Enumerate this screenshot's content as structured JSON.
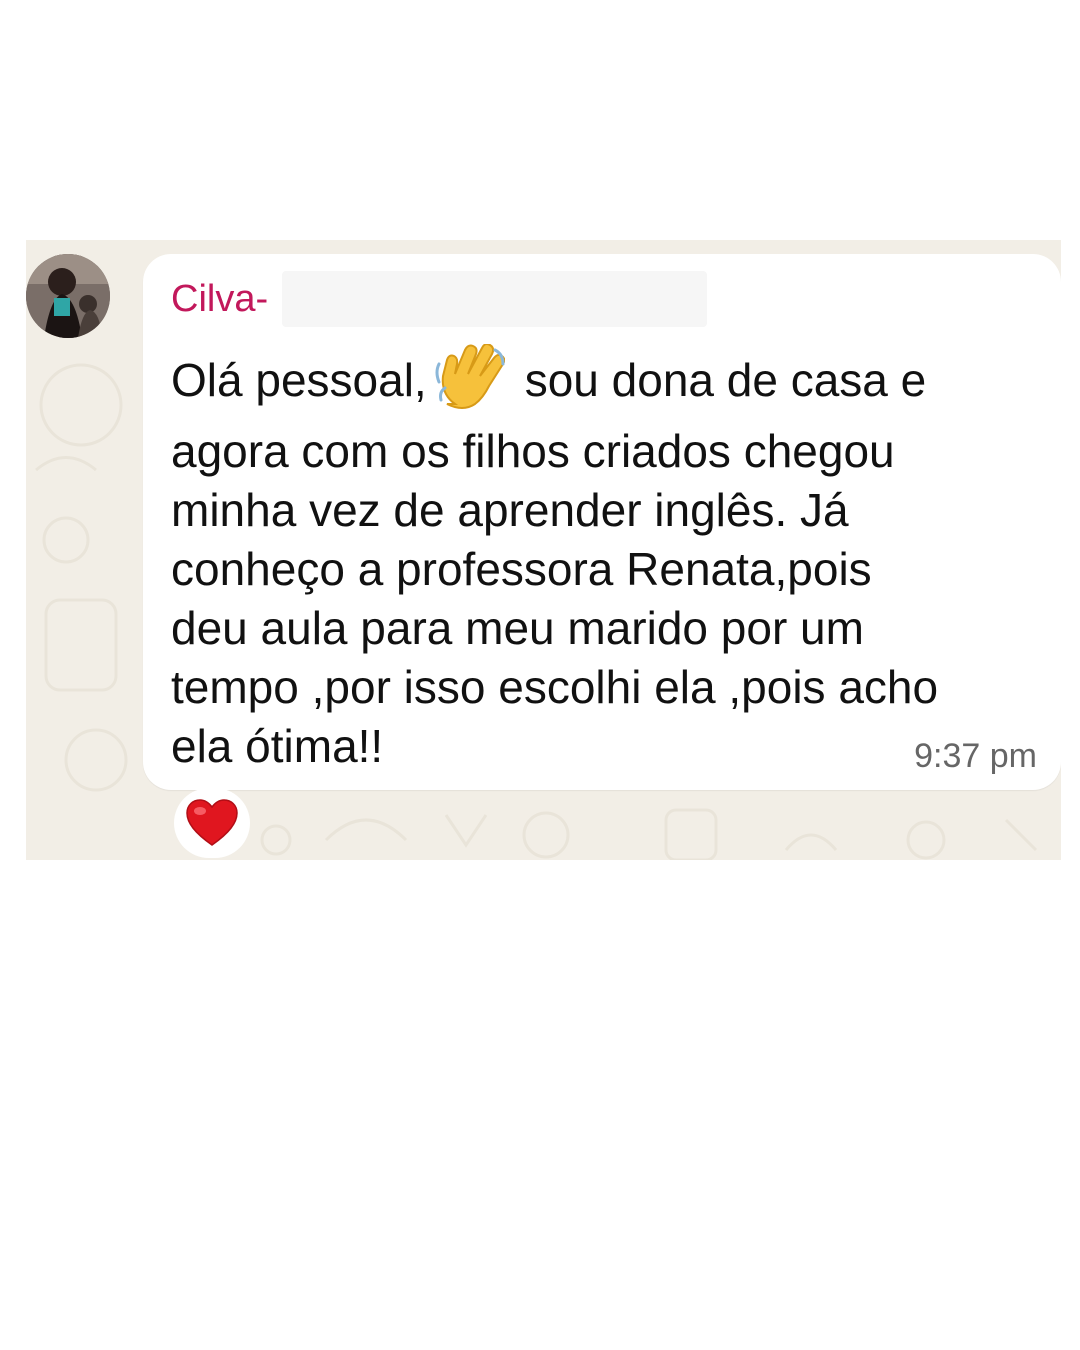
{
  "message": {
    "sender_name": "Cilva-",
    "text_lines": [
      [
        "Olá pessoal,",
        "sou dona de casa  e"
      ],
      "agora com os filhos criados chegou",
      "minha vez de aprender inglês. Já",
      "conheço a professora Renata,pois",
      "deu aula para meu marido por um",
      "tempo ,por isso escolhi ela ,pois acho",
      "ela ótima!!"
    ],
    "inline_emoji": "waving-hand-icon",
    "timestamp": "9:37 pm",
    "reaction_emoji": "red-heart-icon"
  },
  "colors": {
    "sender_name": "#c2185b",
    "wallpaper": "#f2eee6",
    "bubble": "#ffffff",
    "timestamp": "#666666",
    "heart": "#e0161f"
  }
}
